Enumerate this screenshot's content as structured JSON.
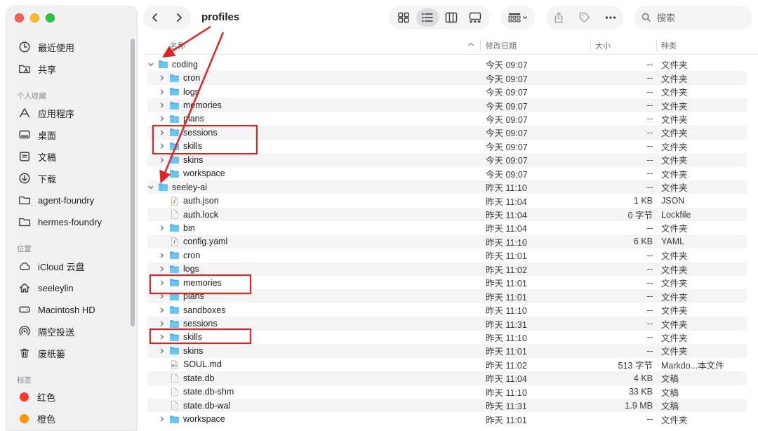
{
  "window": {
    "title": "profiles"
  },
  "sidebar": {
    "top_items": [
      {
        "label": "最近使用",
        "icon": "clock-icon"
      },
      {
        "label": "共享",
        "icon": "shared-folder-icon"
      }
    ],
    "favorites_title": "个人收藏",
    "favorites": [
      {
        "label": "应用程序",
        "icon": "applications-icon"
      },
      {
        "label": "桌面",
        "icon": "desktop-icon"
      },
      {
        "label": "文稿",
        "icon": "document-icon"
      },
      {
        "label": "下载",
        "icon": "download-icon"
      },
      {
        "label": "agent-foundry",
        "icon": "folder-icon"
      },
      {
        "label": "hermes-foundry",
        "icon": "folder-icon"
      }
    ],
    "locations_title": "位置",
    "locations": [
      {
        "label": "iCloud 云盘",
        "icon": "cloud-icon"
      },
      {
        "label": "seeleylin",
        "icon": "home-icon"
      },
      {
        "label": "Macintosh HD",
        "icon": "disk-icon"
      },
      {
        "label": "隔空投送",
        "icon": "airdrop-icon"
      },
      {
        "label": "废纸篓",
        "icon": "trash-icon"
      }
    ],
    "tags_title": "标签",
    "tags": [
      {
        "label": "红色",
        "color": "#ff3b30"
      },
      {
        "label": "橙色",
        "color": "#ff9500"
      }
    ]
  },
  "toolbar": {
    "search_placeholder": "搜索"
  },
  "columns": {
    "name": "名称",
    "date": "修改日期",
    "size": "大小",
    "kind": "种类"
  },
  "rows": [
    {
      "name": "coding",
      "type": "folder",
      "level": 0,
      "expanded": true,
      "date": "今天 09:07",
      "size": "--",
      "kind": "文件夹"
    },
    {
      "name": "cron",
      "type": "folder",
      "level": 1,
      "expanded": false,
      "date": "今天 09:07",
      "size": "--",
      "kind": "文件夹"
    },
    {
      "name": "logs",
      "type": "folder",
      "level": 1,
      "expanded": false,
      "date": "今天 09:07",
      "size": "--",
      "kind": "文件夹"
    },
    {
      "name": "memories",
      "type": "folder",
      "level": 1,
      "expanded": false,
      "date": "今天 09:07",
      "size": "--",
      "kind": "文件夹"
    },
    {
      "name": "plans",
      "type": "folder",
      "level": 1,
      "expanded": false,
      "date": "今天 09:07",
      "size": "--",
      "kind": "文件夹"
    },
    {
      "name": "sessions",
      "type": "folder",
      "level": 1,
      "expanded": false,
      "date": "今天 09:07",
      "size": "--",
      "kind": "文件夹"
    },
    {
      "name": "skills",
      "type": "folder",
      "level": 1,
      "expanded": false,
      "date": "今天 09:07",
      "size": "--",
      "kind": "文件夹"
    },
    {
      "name": "skins",
      "type": "folder",
      "level": 1,
      "expanded": false,
      "date": "今天 09:07",
      "size": "--",
      "kind": "文件夹"
    },
    {
      "name": "workspace",
      "type": "folder",
      "level": 1,
      "expanded": false,
      "date": "今天 09:07",
      "size": "--",
      "kind": "文件夹"
    },
    {
      "name": "seeley-ai",
      "type": "folder",
      "level": 0,
      "expanded": true,
      "date": "昨天 11:10",
      "size": "--",
      "kind": "文件夹"
    },
    {
      "name": "auth.json",
      "type": "json",
      "level": 1,
      "date": "昨天 11:04",
      "size": "1 KB",
      "kind": "JSON"
    },
    {
      "name": "auth.lock",
      "type": "file",
      "level": 1,
      "date": "昨天 11:04",
      "size": "0 字节",
      "kind": "Lockfile"
    },
    {
      "name": "bin",
      "type": "folder",
      "level": 1,
      "expanded": false,
      "date": "昨天 11:04",
      "size": "--",
      "kind": "文件夹"
    },
    {
      "name": "config.yaml",
      "type": "yaml",
      "level": 1,
      "date": "昨天 11:10",
      "size": "6 KB",
      "kind": "YAML"
    },
    {
      "name": "cron",
      "type": "folder",
      "level": 1,
      "expanded": false,
      "date": "昨天 11:01",
      "size": "--",
      "kind": "文件夹"
    },
    {
      "name": "logs",
      "type": "folder",
      "level": 1,
      "expanded": false,
      "date": "昨天 11:02",
      "size": "--",
      "kind": "文件夹"
    },
    {
      "name": "memories",
      "type": "folder",
      "level": 1,
      "expanded": false,
      "date": "昨天 11:01",
      "size": "--",
      "kind": "文件夹"
    },
    {
      "name": "plans",
      "type": "folder",
      "level": 1,
      "expanded": false,
      "date": "昨天 11:01",
      "size": "--",
      "kind": "文件夹"
    },
    {
      "name": "sandboxes",
      "type": "folder",
      "level": 1,
      "expanded": false,
      "date": "昨天 11:10",
      "size": "--",
      "kind": "文件夹"
    },
    {
      "name": "sessions",
      "type": "folder",
      "level": 1,
      "expanded": false,
      "date": "昨天 11:31",
      "size": "--",
      "kind": "文件夹"
    },
    {
      "name": "skills",
      "type": "folder",
      "level": 1,
      "expanded": false,
      "date": "昨天 11:10",
      "size": "--",
      "kind": "文件夹"
    },
    {
      "name": "skins",
      "type": "folder",
      "level": 1,
      "expanded": false,
      "date": "昨天 11:01",
      "size": "--",
      "kind": "文件夹"
    },
    {
      "name": "SOUL.md",
      "type": "markdown",
      "level": 1,
      "date": "昨天 11:02",
      "size": "513 字节",
      "kind": "Markdo...本文件"
    },
    {
      "name": "state.db",
      "type": "file",
      "level": 1,
      "date": "昨天 11:04",
      "size": "4 KB",
      "kind": "文稿"
    },
    {
      "name": "state.db-shm",
      "type": "file",
      "level": 1,
      "date": "昨天 11:10",
      "size": "33 KB",
      "kind": "文稿"
    },
    {
      "name": "state.db-wal",
      "type": "file",
      "level": 1,
      "date": "昨天 11:31",
      "size": "1.9 MB",
      "kind": "文稿"
    },
    {
      "name": "workspace",
      "type": "folder",
      "level": 1,
      "expanded": false,
      "date": "昨天 11:01",
      "size": "--",
      "kind": "文件夹"
    }
  ],
  "colors": {
    "folder": "#4fb3ea",
    "folder_tab": "#2f9ae0",
    "annotation": "#e02424"
  }
}
